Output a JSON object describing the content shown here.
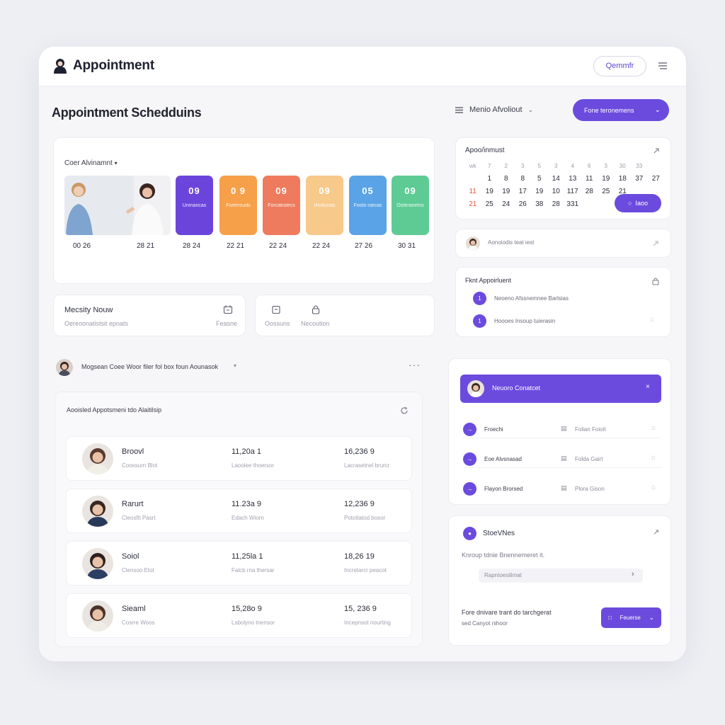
{
  "app": {
    "title": "Appointment",
    "top_button": "Qemmfr",
    "page_title": "Appointment Schedduins",
    "menu_label": "Menio Afvoliout",
    "new_button": "Fone teronemens"
  },
  "overview": {
    "label": "Coer Alvinamnt",
    "tiles": [
      {
        "icon": "09",
        "text": "Unmaricas",
        "color": "#6b45db"
      },
      {
        "icon": "0 9",
        "text": "Forerrouds",
        "color": "#f6a04a"
      },
      {
        "icon": "09",
        "text": "Forcatrolecs",
        "color": "#ee7b5e"
      },
      {
        "icon": "09",
        "text": "Hortionas",
        "color": "#f7c98a"
      },
      {
        "icon": "05",
        "text": "Footo niecas",
        "color": "#5aa3e6"
      },
      {
        "icon": "09",
        "text": "Ooteranetns",
        "color": "#5ecb95"
      }
    ],
    "dates": [
      "00 26",
      "28 21",
      "28 24",
      "22 21",
      "22 24",
      "22 24",
      "27 26",
      "30 31"
    ]
  },
  "weekly": {
    "title": "Mecsity Nouw",
    "subtitle": "Oereoonatistsit epnats",
    "right_label": "Feasne"
  },
  "quick": {
    "item1": "Oossuns",
    "item2": "Necoution"
  },
  "filter": {
    "text": "Mogsean Coee Woor filer fol box foun Aounasok"
  },
  "list": {
    "title": "Aooisled Appotsmeni tdo Alaitilsip",
    "rows": [
      {
        "name": "Broovl",
        "sub": "Coossurn Blot",
        "c2": "11,20a 1",
        "c2s": "Laoolee thoersor",
        "c3": "16,236 9",
        "c3s": "Lacrasetnel brurcr"
      },
      {
        "name": "Rarurt",
        "sub": "Cleosfit Pasrt",
        "c2": "11.23a 9",
        "c2s": "Edach Wiorn",
        "c3": "12,236 9",
        "c3s": "Pototlatod bosor"
      },
      {
        "name": "Soiol",
        "sub": "Clensoo Etot",
        "c2": "11,25la 1",
        "c2s": "Falcb rna thersar",
        "c3": "18,26 19",
        "c3s": "Incretarcr peacot"
      },
      {
        "name": "Sieaml",
        "sub": "Cosrre Woos",
        "c2": "15,28o 9",
        "c2s": "Lsbolyno tnensor",
        "c3": "15, 236 9",
        "c3s": "Incepnsot nourting"
      }
    ]
  },
  "calendar": {
    "title": "Apoo/inmust",
    "header": [
      "wk",
      "7",
      "2",
      "3",
      "5",
      "3",
      "4",
      "6",
      "3",
      "30",
      "33",
      ""
    ],
    "rows": [
      [
        "",
        "1",
        "8",
        "8",
        "5",
        "14",
        "13",
        "11",
        "19",
        "18",
        "37",
        "27"
      ],
      [
        "11",
        "19",
        "19",
        "17",
        "19",
        "10",
        "117",
        "28",
        "25",
        "21",
        "",
        ""
      ],
      [
        "21",
        "25",
        "24",
        "26",
        "38",
        "28",
        "331",
        "",
        "",
        "",
        "",
        ""
      ]
    ],
    "button": "Iaoo"
  },
  "reminder": {
    "text": "Aonoiodis teat iest"
  },
  "first_appt": {
    "title": "Fknt Appoirluent",
    "items": [
      {
        "num": "1",
        "text": "Neoeno Afssnemnee Barlsias"
      },
      {
        "num": "1",
        "text": "Hoooes Insoup tuierasin"
      }
    ]
  },
  "people": {
    "selected": "Neuoro Conatcet",
    "rows": [
      {
        "name": "Froechi",
        "tag": "Folian Foioit"
      },
      {
        "name": "Eoe Alvsnasad",
        "tag": "Folda Gairt"
      },
      {
        "name": "Flayon Brorsed",
        "tag": "Plora Gison"
      }
    ]
  },
  "services": {
    "title": "StoeVNes",
    "subtitle": "Knroup tdnie Bnennemeret it.",
    "input": "Rapntoesilimat",
    "note_line1": "Fore dnivare trant do tarchgerat",
    "note_line2": "sed Canyot nihoor",
    "button": "Feuerse"
  },
  "colors": {
    "accent": "#6b4bde",
    "red": "#e2573f"
  }
}
